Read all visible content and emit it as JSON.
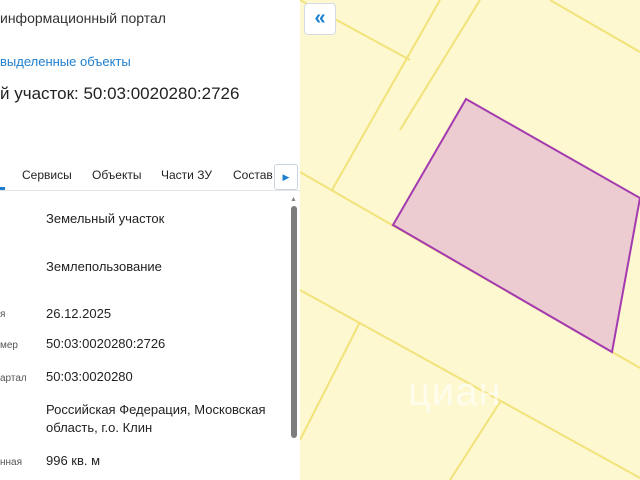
{
  "header": {
    "portal_title": "информационный портал",
    "selected_objects_link": "выделенные объекты",
    "object_heading": "й участок: 50:03:0020280:2726"
  },
  "tabs": [
    "Сервисы",
    "Объекты",
    "Части ЗУ",
    "Состав"
  ],
  "tab_more_icon": "chevron-right-icon",
  "properties": [
    {
      "label": "",
      "value": "Земельный участок"
    },
    {
      "label": "",
      "value": "Землепользование"
    },
    {
      "label": "я",
      "value": "26.12.2025"
    },
    {
      "label": "мер",
      "value": "50:03:0020280:2726"
    },
    {
      "label": "артал",
      "value": "50:03:0020280"
    },
    {
      "label": "",
      "value": "Российская Федерация, Московская",
      "value2": "область, г.о. Клин"
    },
    {
      "label": "нная",
      "value": "996 кв. м"
    }
  ],
  "map": {
    "collapse_button_icon": "double-chevron-left-icon",
    "collapse_glyph": "«",
    "watermark": "циан",
    "background_color": "#fdf8cf",
    "boundary_color": "#f2e27a",
    "parcel_fill": "#ecccd0",
    "parcel_stroke": "#a43ab0"
  }
}
